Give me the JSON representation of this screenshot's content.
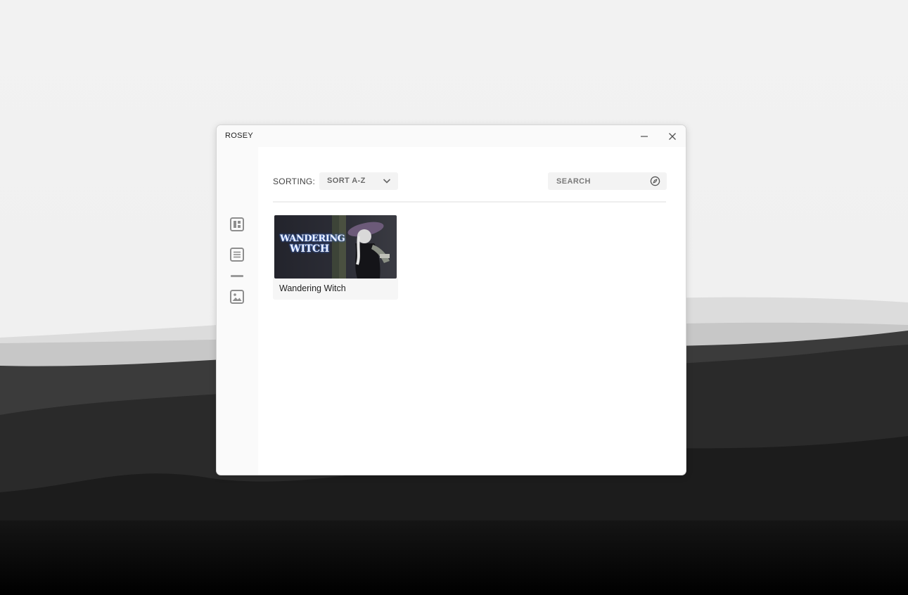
{
  "window": {
    "title": "ROSEY",
    "minimize_icon": "minimize-icon",
    "close_icon": "close-icon"
  },
  "sidebar": {
    "items": [
      {
        "icon": "dashboard-icon"
      },
      {
        "icon": "list-icon"
      },
      {
        "icon": "image-icon"
      }
    ]
  },
  "toolbar": {
    "sorting_label": "SORTING:",
    "sort_value": "SORT A-Z",
    "search_placeholder": "SEARCH",
    "search_icon": "compass-icon"
  },
  "library": {
    "items": [
      {
        "title": "Wandering Witch",
        "cover_logo_line1": "WANDERING",
        "cover_logo_line2": "WITCH"
      }
    ]
  }
}
